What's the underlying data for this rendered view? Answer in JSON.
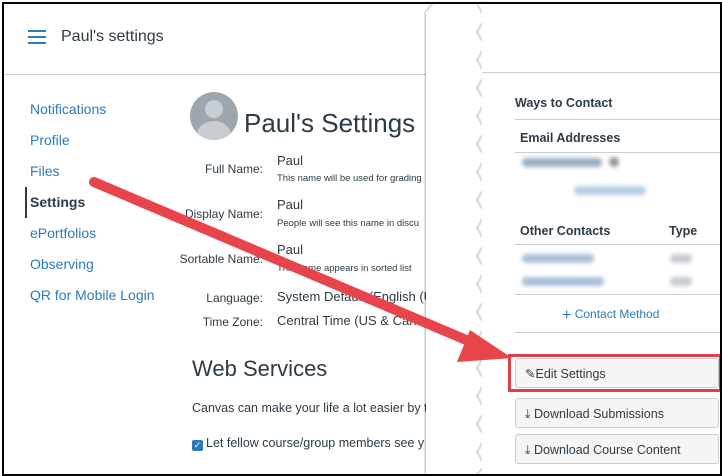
{
  "topbar": {
    "title": "Paul's settings"
  },
  "nav": {
    "items": [
      {
        "label": "Notifications"
      },
      {
        "label": "Profile"
      },
      {
        "label": "Files"
      },
      {
        "label": "Settings"
      },
      {
        "label": "ePortfolios"
      },
      {
        "label": "Observing"
      },
      {
        "label": "QR for Mobile Login"
      }
    ]
  },
  "profile": {
    "title": "Paul's Settings",
    "full_name": {
      "label": "Full Name:",
      "value": "Paul",
      "note": "This name will be used for grading"
    },
    "display_name": {
      "label": "Display Name:",
      "value": "Paul",
      "note": "People will see this name in discu"
    },
    "sortable_name": {
      "label": "Sortable Name:",
      "value": "Paul",
      "note": "This name appears in sorted list"
    },
    "language": {
      "label": "Language:",
      "value": "System Default (English (U"
    },
    "time_zone": {
      "label": "Time Zone:",
      "value": "Central Time (US & Cana"
    }
  },
  "web_services": {
    "heading": "Web Services",
    "description": "Canvas can make your life a lot easier by t",
    "checkbox_label": "Let fellow course/group members see y"
  },
  "contact": {
    "heading": "Ways to Contact",
    "email_heading": "Email Addresses",
    "other_heading": "Other Contacts",
    "type_heading": "Type",
    "add_contact_method": "Contact Method"
  },
  "actions": {
    "edit_settings": "Edit Settings",
    "download_submissions": "Download Submissions",
    "download_course_content": "Download Course Content"
  },
  "colors": {
    "link": "#2b7abc",
    "highlight": "#e03e48",
    "arrow": "#e8444c"
  }
}
